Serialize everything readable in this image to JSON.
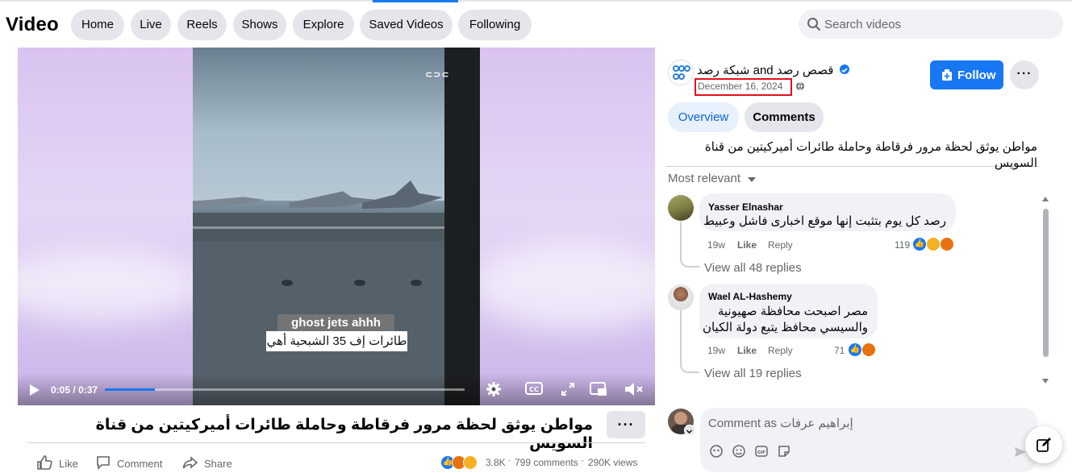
{
  "app": {
    "title": "Video"
  },
  "nav": {
    "items": [
      "Home",
      "Live",
      "Reels",
      "Shows",
      "Explore",
      "Saved Videos",
      "Following"
    ]
  },
  "search": {
    "placeholder": "Search videos"
  },
  "player": {
    "caption_en": "ghost jets ahhh",
    "caption_ar": "طائرات إف 35 الشبحية أهي",
    "time": "0:05 / 0:37",
    "progress": 0.14,
    "icons": [
      "play-icon",
      "settings-icon",
      "captions-icon",
      "fullscreen-icon",
      "miniplayer-icon",
      "mute-icon"
    ]
  },
  "video": {
    "title": "مواطن يوثق لحظة مرور فرقاطة وحاملة طائرات أميركيتين من قناة السويس",
    "actions": {
      "like": "Like",
      "comment": "Comment",
      "share": "Share"
    },
    "reactions_count": "3.8K",
    "comments_count": "799 comments",
    "views": "290K views",
    "more": "···"
  },
  "page": {
    "name": "شبكة رصد and قصص رصد",
    "date": "December 16, 2024",
    "follow_label": "Follow",
    "more": "···"
  },
  "tabs": {
    "overview": "Overview",
    "comments": "Comments"
  },
  "description": "مواطن يوثق لحظة مرور فرقاطة وحاملة طائرات أميركيتين من قناة السويس",
  "sort": {
    "label": "Most relevant"
  },
  "comments": [
    {
      "author": "Yasser Elnashar",
      "lines": [
        "رصد كل يوم بتثبت إنها موقع اخبارى فاشل وعبيط"
      ],
      "age": "19w",
      "like": "Like",
      "reply": "Reply",
      "reactions": "119",
      "view_replies": "View all 48 replies"
    },
    {
      "author": "Wael AL-Hashemy",
      "lines": [
        "مصر اصبحت محافظة صهيونية",
        "والسيسي محافظ يتبع دولة الكيان"
      ],
      "age": "19w",
      "like": "Like",
      "reply": "Reply",
      "reactions": "71",
      "view_replies": "View all 19 replies"
    }
  ],
  "composer": {
    "placeholder": "Comment as إبراهيم عرفات"
  },
  "colors": {
    "accent": "#1877f2",
    "highlight_box": "#e4101d",
    "surface": "#f0f2f5"
  }
}
